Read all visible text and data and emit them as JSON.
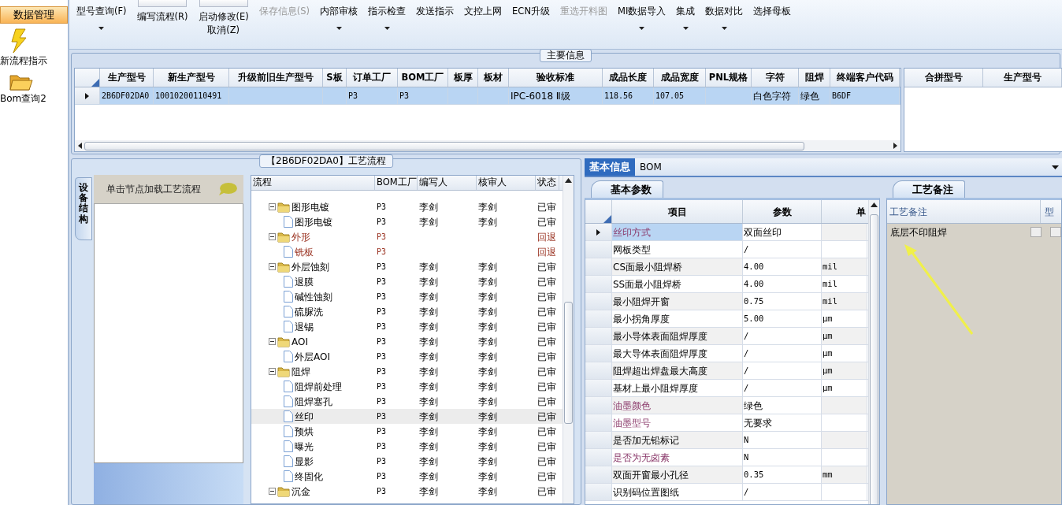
{
  "sidebar": {
    "section": "数据管理",
    "items": [
      {
        "label": "新流程指示",
        "kind": "lightning"
      },
      {
        "label": "Bom查询2",
        "kind": "folder"
      }
    ]
  },
  "toolbar": [
    {
      "label": "型号查询(F)",
      "kind": "text",
      "dropdown": true,
      "disabled": false
    },
    {
      "label": "编写流程(R)",
      "kind": "split",
      "dropdown": false,
      "disabled": false
    },
    {
      "label": "启动修改(E)",
      "label2": "取消(Z)",
      "kind": "split",
      "dropdown": false,
      "disabled": false
    },
    {
      "label": "保存信息(S)",
      "kind": "text",
      "dropdown": false,
      "disabled": true
    },
    {
      "label": "内部审核",
      "kind": "text",
      "dropdown": true,
      "disabled": false
    },
    {
      "label": "指示检查",
      "kind": "text",
      "dropdown": true,
      "disabled": false
    },
    {
      "label": "发送指示",
      "kind": "text",
      "dropdown": false,
      "disabled": false
    },
    {
      "label": "文控上网",
      "kind": "text",
      "dropdown": false,
      "disabled": false
    },
    {
      "label": "ECN升级",
      "kind": "text",
      "dropdown": false,
      "disabled": false
    },
    {
      "label": "重选开料图",
      "kind": "text",
      "dropdown": false,
      "disabled": true
    },
    {
      "label": "MI数据导入",
      "kind": "text",
      "dropdown": true,
      "disabled": false
    },
    {
      "label": "集成",
      "kind": "text",
      "dropdown": true,
      "disabled": false
    },
    {
      "label": "数据对比",
      "kind": "text",
      "dropdown": true,
      "disabled": false
    },
    {
      "label": "选择母板",
      "kind": "text",
      "dropdown": false,
      "disabled": false
    }
  ],
  "main_info": {
    "title": "主要信息",
    "columns": [
      "生产型号",
      "新生产型号",
      "升级前旧生产型号",
      "S板",
      "订单工厂",
      "BOM工厂",
      "板厚",
      "板材",
      "验收标准",
      "成品长度",
      "成品宽度",
      "PNL规格",
      "字符",
      "阻焊",
      "终端客户代码"
    ],
    "rows": [
      {
        "selected": true,
        "cells": [
          "2B6DF02DA0",
          "10010200110491",
          null,
          null,
          "P3",
          "P3",
          null,
          null,
          "IPC-6018 Ⅱ级",
          "118.56",
          "107.05",
          null,
          "白色字符",
          "绿色",
          "B6DF"
        ]
      }
    ],
    "merge_columns": [
      "合拼型号",
      "生产型号"
    ]
  },
  "process": {
    "title": "【2B6DF02DA0】工艺流程",
    "side_tab": "设备结构",
    "hint": "单击节点加载工艺流程",
    "columns": [
      "流程",
      "BOM工厂",
      "编写人",
      "核审人",
      "状态"
    ],
    "tree": [
      {
        "label": "图形电镀",
        "kind": "folder",
        "expanded": true,
        "bom": "P3",
        "writer": "李剑",
        "reviewer": "李剑",
        "status": "已审",
        "color": "#000000",
        "selected": false,
        "children": [
          {
            "label": "图形电镀",
            "kind": "step",
            "bom": "P3",
            "writer": "李剑",
            "reviewer": "李剑",
            "status": "已审",
            "color": "#000000",
            "selected": false
          }
        ]
      },
      {
        "label": "外形",
        "kind": "folder",
        "expanded": true,
        "bom": "P3",
        "status": "回退",
        "color": "#9a3322",
        "selected": false,
        "children": [
          {
            "label": "铣板",
            "kind": "step",
            "bom": "P3",
            "status": "回退",
            "color": "#9a3322",
            "selected": false
          }
        ]
      },
      {
        "label": "外层蚀刻",
        "kind": "folder",
        "expanded": true,
        "bom": "P3",
        "writer": "李剑",
        "reviewer": "李剑",
        "status": "已审",
        "color": "#000000",
        "selected": false,
        "children": [
          {
            "label": "退膜",
            "kind": "step",
            "bom": "P3",
            "writer": "李剑",
            "reviewer": "李剑",
            "status": "已审",
            "color": "#000000",
            "selected": false
          },
          {
            "label": "碱性蚀刻",
            "kind": "step",
            "bom": "P3",
            "writer": "李剑",
            "reviewer": "李剑",
            "status": "已审",
            "color": "#000000",
            "selected": false
          },
          {
            "label": "硫脲洗",
            "kind": "step",
            "bom": "P3",
            "writer": "李剑",
            "reviewer": "李剑",
            "status": "已审",
            "color": "#000000",
            "selected": false
          },
          {
            "label": "退锡",
            "kind": "step",
            "bom": "P3",
            "writer": "李剑",
            "reviewer": "李剑",
            "status": "已审",
            "color": "#000000",
            "selected": false
          }
        ]
      },
      {
        "label": "AOI",
        "kind": "folder",
        "expanded": true,
        "bom": "P3",
        "writer": "李剑",
        "reviewer": "李剑",
        "status": "已审",
        "color": "#000000",
        "selected": false,
        "children": [
          {
            "label": "外层AOI",
            "kind": "step",
            "bom": "P3",
            "writer": "李剑",
            "reviewer": "李剑",
            "status": "已审",
            "color": "#000000",
            "selected": false
          }
        ]
      },
      {
        "label": "阻焊",
        "kind": "folder",
        "expanded": true,
        "bom": "P3",
        "writer": "李剑",
        "reviewer": "李剑",
        "status": "已审",
        "color": "#000000",
        "selected": false,
        "children": [
          {
            "label": "阻焊前处理",
            "kind": "step",
            "bom": "P3",
            "writer": "李剑",
            "reviewer": "李剑",
            "status": "已审",
            "color": "#000000",
            "selected": false
          },
          {
            "label": "阻焊塞孔",
            "kind": "step",
            "bom": "P3",
            "writer": "李剑",
            "reviewer": "李剑",
            "status": "已审",
            "color": "#000000",
            "selected": false
          },
          {
            "label": "丝印",
            "kind": "step",
            "bom": "P3",
            "writer": "李剑",
            "reviewer": "李剑",
            "status": "已审",
            "color": "#000000",
            "selected": true
          },
          {
            "label": "预烘",
            "kind": "step",
            "bom": "P3",
            "writer": "李剑",
            "reviewer": "李剑",
            "status": "已审",
            "color": "#000000",
            "selected": false
          },
          {
            "label": "曝光",
            "kind": "step",
            "bom": "P3",
            "writer": "李剑",
            "reviewer": "李剑",
            "status": "已审",
            "color": "#000000",
            "selected": false
          },
          {
            "label": "显影",
            "kind": "step",
            "bom": "P3",
            "writer": "李剑",
            "reviewer": "李剑",
            "status": "已审",
            "color": "#000000",
            "selected": false
          },
          {
            "label": "终固化",
            "kind": "step",
            "bom": "P3",
            "writer": "李剑",
            "reviewer": "李剑",
            "status": "已审",
            "color": "#000000",
            "selected": false
          }
        ]
      },
      {
        "label": "沉金",
        "kind": "folder",
        "expanded": true,
        "bom": "P3",
        "writer": "李剑",
        "reviewer": "李剑",
        "status": "已审",
        "color": "#000000",
        "selected": false
      }
    ]
  },
  "detail": {
    "tabs": [
      {
        "label": "基本信息",
        "selected": true
      },
      {
        "label": "BOM",
        "selected": false
      }
    ],
    "params": {
      "tab": "基本参数",
      "columns": [
        "项目",
        "参数",
        "单"
      ],
      "rows": [
        {
          "name": "丝印方式",
          "value": "双面丝印",
          "emphasized": true,
          "selected": true
        },
        {
          "name": "网板类型",
          "value": "/",
          "emphasized": false,
          "selected": false
        },
        {
          "name": "CS面最小阻焊桥",
          "value": "4.00",
          "unit": "mil",
          "emphasized": false,
          "selected": false
        },
        {
          "name": "SS面最小阻焊桥",
          "value": "4.00",
          "unit": "mil",
          "emphasized": false,
          "selected": false
        },
        {
          "name": "最小阻焊开窗",
          "value": "0.75",
          "unit": "mil",
          "emphasized": false,
          "selected": false
        },
        {
          "name": "最小拐角厚度",
          "value": "5.00",
          "unit": "μm",
          "emphasized": false,
          "selected": false
        },
        {
          "name": "最小导体表面阻焊厚度",
          "value": "/",
          "unit": "μm",
          "emphasized": false,
          "selected": false
        },
        {
          "name": "最大导体表面阻焊厚度",
          "value": "/",
          "unit": "μm",
          "emphasized": false,
          "selected": false
        },
        {
          "name": "阻焊超出焊盘最大高度",
          "value": "/",
          "unit": "μm",
          "emphasized": false,
          "selected": false
        },
        {
          "name": "基材上最小阻焊厚度",
          "value": "/",
          "unit": "μm",
          "emphasized": false,
          "selected": false
        },
        {
          "name": "油墨颜色",
          "value": "绿色",
          "emphasized": true,
          "selected": false
        },
        {
          "name": "油墨型号",
          "value": "无要求",
          "emphasized": true,
          "selected": false
        },
        {
          "name": "是否加无铅标记",
          "value": "N",
          "emphasized": false,
          "selected": false
        },
        {
          "name": "是否为无卤素",
          "value": "N",
          "emphasized": true,
          "selected": false
        },
        {
          "name": "双面开窗最小孔径",
          "value": "0.35",
          "unit": "mm",
          "emphasized": false,
          "selected": false
        },
        {
          "name": "识别码位置图纸",
          "value": "/",
          "emphasized": false,
          "selected": false
        }
      ]
    },
    "remarks": {
      "tab": "工艺备注",
      "columns": [
        "工艺备注",
        "型"
      ],
      "text": "底层不印阻焊"
    }
  }
}
